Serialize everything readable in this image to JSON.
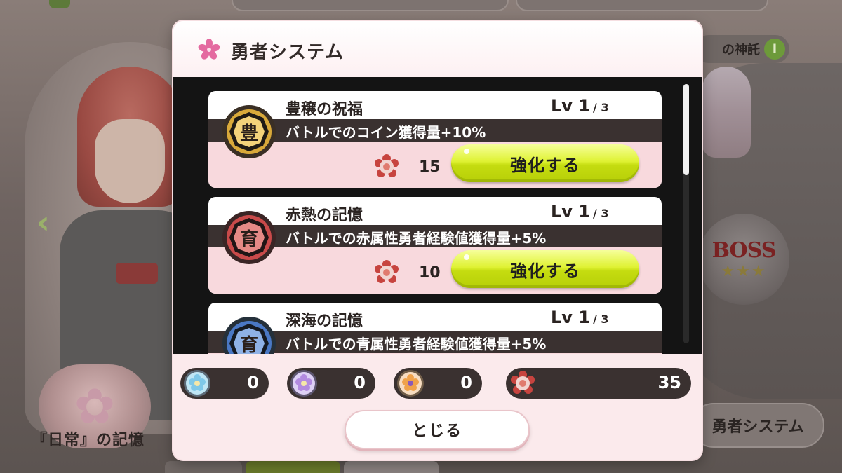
{
  "background": {
    "memory_button_label": "『日常』の記憶",
    "oracle_label": "の神託",
    "info_icon_glyph": "i",
    "hero_system_button_label": "勇者システム",
    "boss_label": "BOSS",
    "boss_stars": "★★★"
  },
  "modal": {
    "title": "勇者システム",
    "title_icon": "sakura-icon",
    "skills": [
      {
        "name": "豊穣の祝福",
        "level_label": "Lv 1",
        "level_max": "/ 3",
        "description": "バトルでのコイン獲得量+10%",
        "emblem_char": "豊",
        "emblem_color": "#d9a93a",
        "cost": "15",
        "button_label": "強化する"
      },
      {
        "name": "赤熱の記憶",
        "level_label": "Lv 1",
        "level_max": "/ 3",
        "description": "バトルでの赤属性勇者経験値獲得量+5%",
        "emblem_char": "育",
        "emblem_color": "#c94a4a",
        "cost": "10",
        "button_label": "強化する"
      },
      {
        "name": "深海の記憶",
        "level_label": "Lv 1",
        "level_max": "/ 3",
        "description": "バトルでの青属性勇者経験値獲得量+5%",
        "emblem_char": "育",
        "emblem_color": "#4a78c4",
        "cost": "",
        "button_label": ""
      }
    ],
    "currencies": [
      {
        "icon": "blue-flower-medal-icon",
        "value": "0",
        "color": "#7fc8e8"
      },
      {
        "icon": "purple-flower-medal-icon",
        "value": "0",
        "color": "#b28ae0"
      },
      {
        "icon": "orange-flower-medal-icon",
        "value": "0",
        "color": "#f0a24a"
      },
      {
        "icon": "red-flower-medal-icon",
        "value": "35",
        "color": "#d9504f"
      }
    ],
    "close_label": "とじる"
  }
}
